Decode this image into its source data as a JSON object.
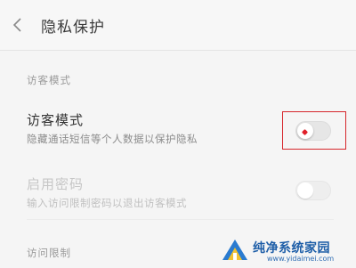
{
  "header": {
    "title": "隐私保护"
  },
  "sections": {
    "visitor_mode_label": "访客模式",
    "access_limit_label": "访问限制"
  },
  "rows": {
    "visitor_mode": {
      "title": "访客模式",
      "subtitle": "隐藏通话短信等个人数据以保护隐私",
      "enabled": false
    },
    "enable_password": {
      "title": "启用密码",
      "subtitle": "输入访问限制密码以退出访客模式",
      "enabled": false,
      "disabled": true
    }
  },
  "watermark": {
    "name": "纯净系统家园",
    "url": "www.yidaimei.com"
  },
  "colors": {
    "highlight": "#d6262b",
    "watermark": "#1f5fa8"
  }
}
